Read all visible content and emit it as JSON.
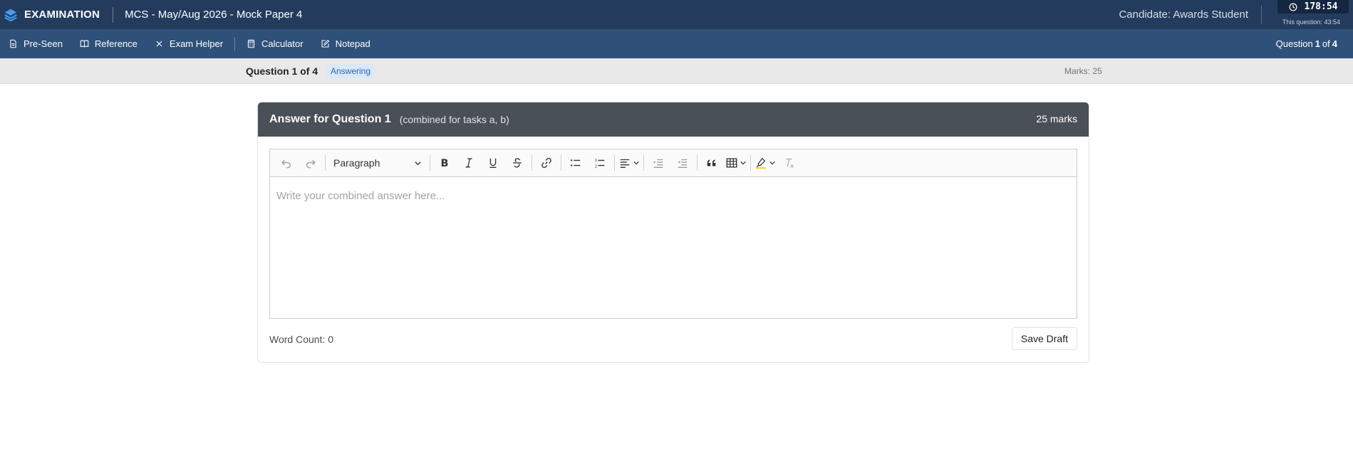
{
  "header": {
    "brand": "EXAMINATION",
    "exam_title": "MCS - May/Aug 2026 - Mock Paper 4",
    "candidate": "Candidate: Awards Student",
    "timer_total": "178:54",
    "timer_question": "This question: 43:54"
  },
  "toolbar": {
    "items": [
      {
        "label": "Pre-Seen",
        "icon": "document-icon"
      },
      {
        "label": "Reference",
        "icon": "book-icon"
      },
      {
        "label": "Exam Helper",
        "icon": "close-x-icon"
      },
      {
        "label": "Calculator",
        "icon": "calculator-icon"
      },
      {
        "label": "Notepad",
        "icon": "edit-icon"
      }
    ],
    "question_prefix": "Question",
    "question_current": "1",
    "question_of": "of",
    "question_total": "4"
  },
  "status": {
    "question_label": "Question 1 of 4",
    "badge": "Answering",
    "marks": "Marks: 25"
  },
  "card": {
    "title": "Answer for Question 1",
    "subtitle": "(combined for tasks a, b)",
    "marks": "25 marks"
  },
  "editor": {
    "block_format": "Paragraph",
    "placeholder": "Write your combined answer here..."
  },
  "footer": {
    "word_count": "Word Count: 0",
    "save_label": "Save Draft"
  },
  "colors": {
    "header_bg": "#233c5e",
    "toolbar_bg": "#2f5079",
    "card_header_bg": "#495057",
    "badge_text": "#2166b8"
  }
}
